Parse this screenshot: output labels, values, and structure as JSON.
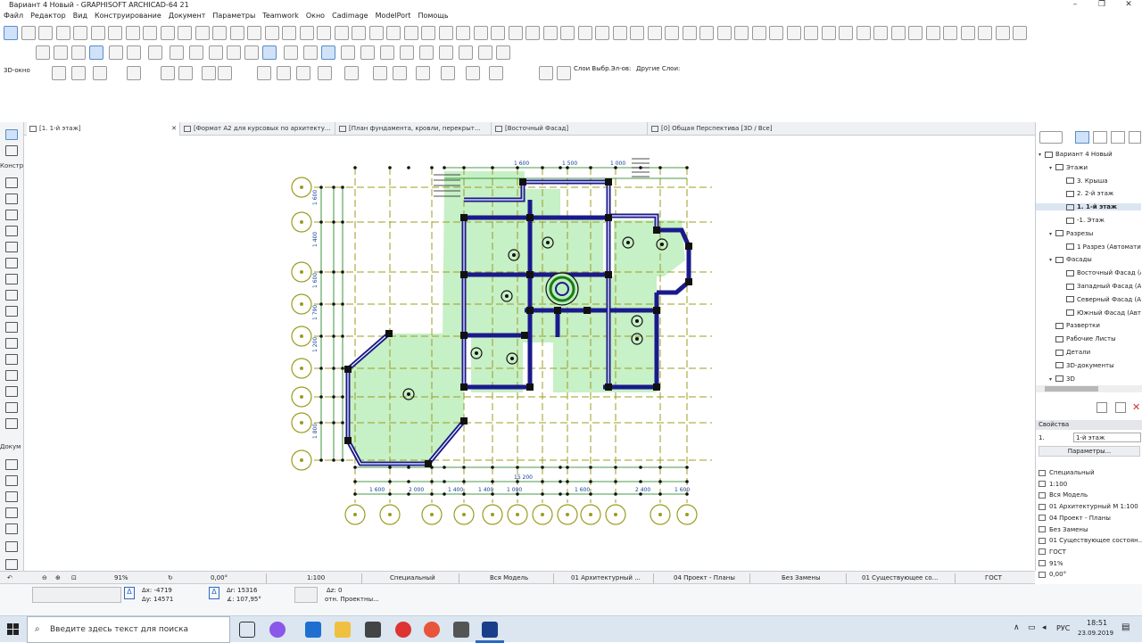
{
  "window": {
    "title": "Вариант 4 Новый - GRAPHISOFT ARCHICAD-64 21"
  },
  "menu": [
    "Файл",
    "Редактор",
    "Вид",
    "Конструирование",
    "Документ",
    "Параметры",
    "Teamwork",
    "Окно",
    "Cadimage",
    "ModelPort",
    "Помощь"
  ],
  "toolbar3": {
    "view_label": "3D-окно",
    "layers_sel_label": "Слои Выбр.Эл-ов:",
    "layers_other_label": "Другие Слои:"
  },
  "tabs": [
    {
      "label": "[1. 1-й этаж]",
      "active": true
    },
    {
      "label": "[Формат А2 для курсовых по архитекту...",
      "active": false
    },
    {
      "label": "[План фундамента, кровли, перекрыт...",
      "active": false
    },
    {
      "label": "[Восточный Фасад]",
      "active": false
    },
    {
      "label": "[0] Общая Перспектива [3D / Все]",
      "active": false
    }
  ],
  "leftbar": {
    "section1": "Констр",
    "section2": "Докум"
  },
  "navigator": {
    "items": [
      {
        "label": "Вариант 4 Новый",
        "level": 0,
        "expanded": true
      },
      {
        "label": "Этажи",
        "level": 1,
        "expanded": true
      },
      {
        "label": "3. Крыша",
        "level": 2
      },
      {
        "label": "2. 2-й этаж",
        "level": 2
      },
      {
        "label": "1. 1-й этаж",
        "level": 2,
        "selected": true
      },
      {
        "label": "-1. Этаж",
        "level": 2
      },
      {
        "label": "Разрезы",
        "level": 1,
        "expanded": true
      },
      {
        "label": "1 Разрез (Автоматич",
        "level": 2
      },
      {
        "label": "Фасады",
        "level": 1,
        "expanded": true
      },
      {
        "label": "Восточный Фасад (А",
        "level": 2
      },
      {
        "label": "Западный Фасад (Ав",
        "level": 2
      },
      {
        "label": "Северный Фасад (Ав",
        "level": 2
      },
      {
        "label": "Южный Фасад (Авто",
        "level": 2
      },
      {
        "label": "Развертки",
        "level": 1
      },
      {
        "label": "Рабочие Листы",
        "level": 1
      },
      {
        "label": "Детали",
        "level": 1
      },
      {
        "label": "3D-документы",
        "level": 1
      },
      {
        "label": "3D",
        "level": 1,
        "expanded": true
      }
    ]
  },
  "properties": {
    "header": "Свойства",
    "floor_number": "1.",
    "floor_name": "1-й этаж",
    "params_button": "Параметры...",
    "lines": [
      "Специальный",
      "1:100",
      "Вся Модель",
      "01 Архитектурный М 1:100",
      "04 Проект - Планы",
      "Без Замены",
      "01 Существующее состоян...",
      "ГОСТ",
      "91%",
      "0,00°"
    ]
  },
  "statusbar": {
    "zoom": "91%",
    "angle": "0,00°",
    "scale": "1:100",
    "layer_combo": "Специальный",
    "model": "Вся Модель",
    "pen_set": "01 Архитектурный ...",
    "model_view": "04 Проект - Планы",
    "override": "Без Замены",
    "renovation": "01 Существующее со...",
    "dimension": "ГОСТ"
  },
  "coords": {
    "dx": "Δx: -4719",
    "dy": "Δy: 14571",
    "dr": "Δr: 15316",
    "angle": "∡: 107,95°",
    "dz": "Δz: 0",
    "ref": "отн. Проектны..."
  },
  "plan": {
    "dims_top": [
      "1 600",
      "1 500",
      "1 000"
    ],
    "dims_bottom": [
      "1 600",
      "2 000",
      "1 400",
      "1 400",
      "1 000",
      "15 200",
      "1 600",
      "2 400",
      "1 600"
    ],
    "dims_left": [
      "1 600",
      "1 400",
      "1 600",
      "1 790",
      "1 200",
      "1 800"
    ]
  },
  "taskbar": {
    "search_placeholder": "Введите здесь текст для поиска",
    "lang": "РУС",
    "time": "18:51",
    "date": "23.09.2019"
  },
  "colors": {
    "wall": "#1a1a8c",
    "floor_fill": "#b9ecb9",
    "gridline": "#8a8a00",
    "dim": "#0a6b0a",
    "accent": "#2b68c4"
  }
}
